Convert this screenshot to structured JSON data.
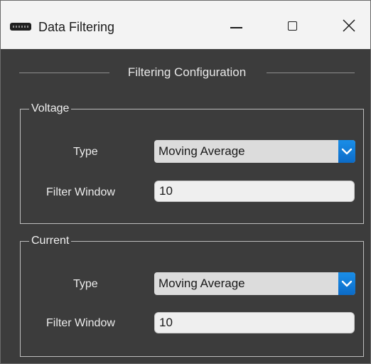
{
  "window": {
    "title": "Data Filtering"
  },
  "titlebar": {
    "icon": "app-icon",
    "minimize_icon": "minimize-icon",
    "maximize_icon": "maximize-icon",
    "close_icon": "close-icon"
  },
  "section": {
    "title": "Filtering Configuration"
  },
  "voltage": {
    "group_title": "Voltage",
    "type_label": "Type",
    "type_value": "Moving Average",
    "window_label": "Filter Window",
    "window_value": "10"
  },
  "current": {
    "group_title": "Current",
    "type_label": "Type",
    "type_value": "Moving Average",
    "window_label": "Filter Window",
    "window_value": "10"
  },
  "colors": {
    "background": "#3c3c3c",
    "titlebar": "#f3f3f3",
    "accent": "#0f78d7",
    "select_bg": "#dcdcdc",
    "input_bg": "#efefef"
  }
}
